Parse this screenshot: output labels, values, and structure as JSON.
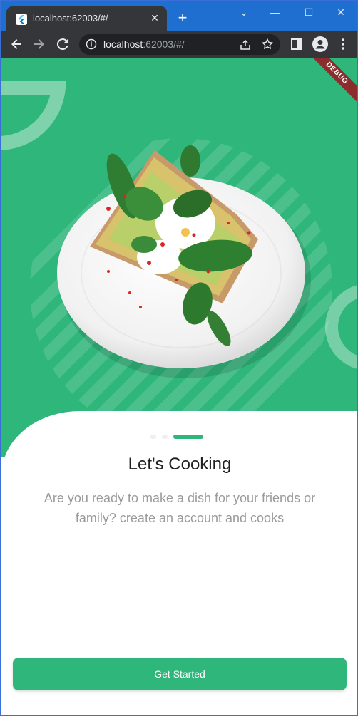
{
  "browser": {
    "tab_title": "localhost:62003/#/",
    "tab_close": "✕",
    "new_tab": "+",
    "window_controls": {
      "minimize": "⌄",
      "minimize2": "—",
      "maximize": "☐",
      "close": "✕"
    },
    "url_host": "localhost",
    "url_rest": ":62003/#/",
    "favicon": "flutter-icon"
  },
  "app": {
    "debug_banner": "DEBUG",
    "heading": "Let's Cooking",
    "subtitle": "Are you ready to make a dish for your friends or family? create an account and cooks",
    "cta_label": "Get Started",
    "page_indicator": {
      "count": 3,
      "active_index": 2
    },
    "colors": {
      "brand": "#2fb67a",
      "debug_banner": "#8b2d2d"
    },
    "hero_image": "plate-with-avocado-toast-egg-spinach"
  }
}
